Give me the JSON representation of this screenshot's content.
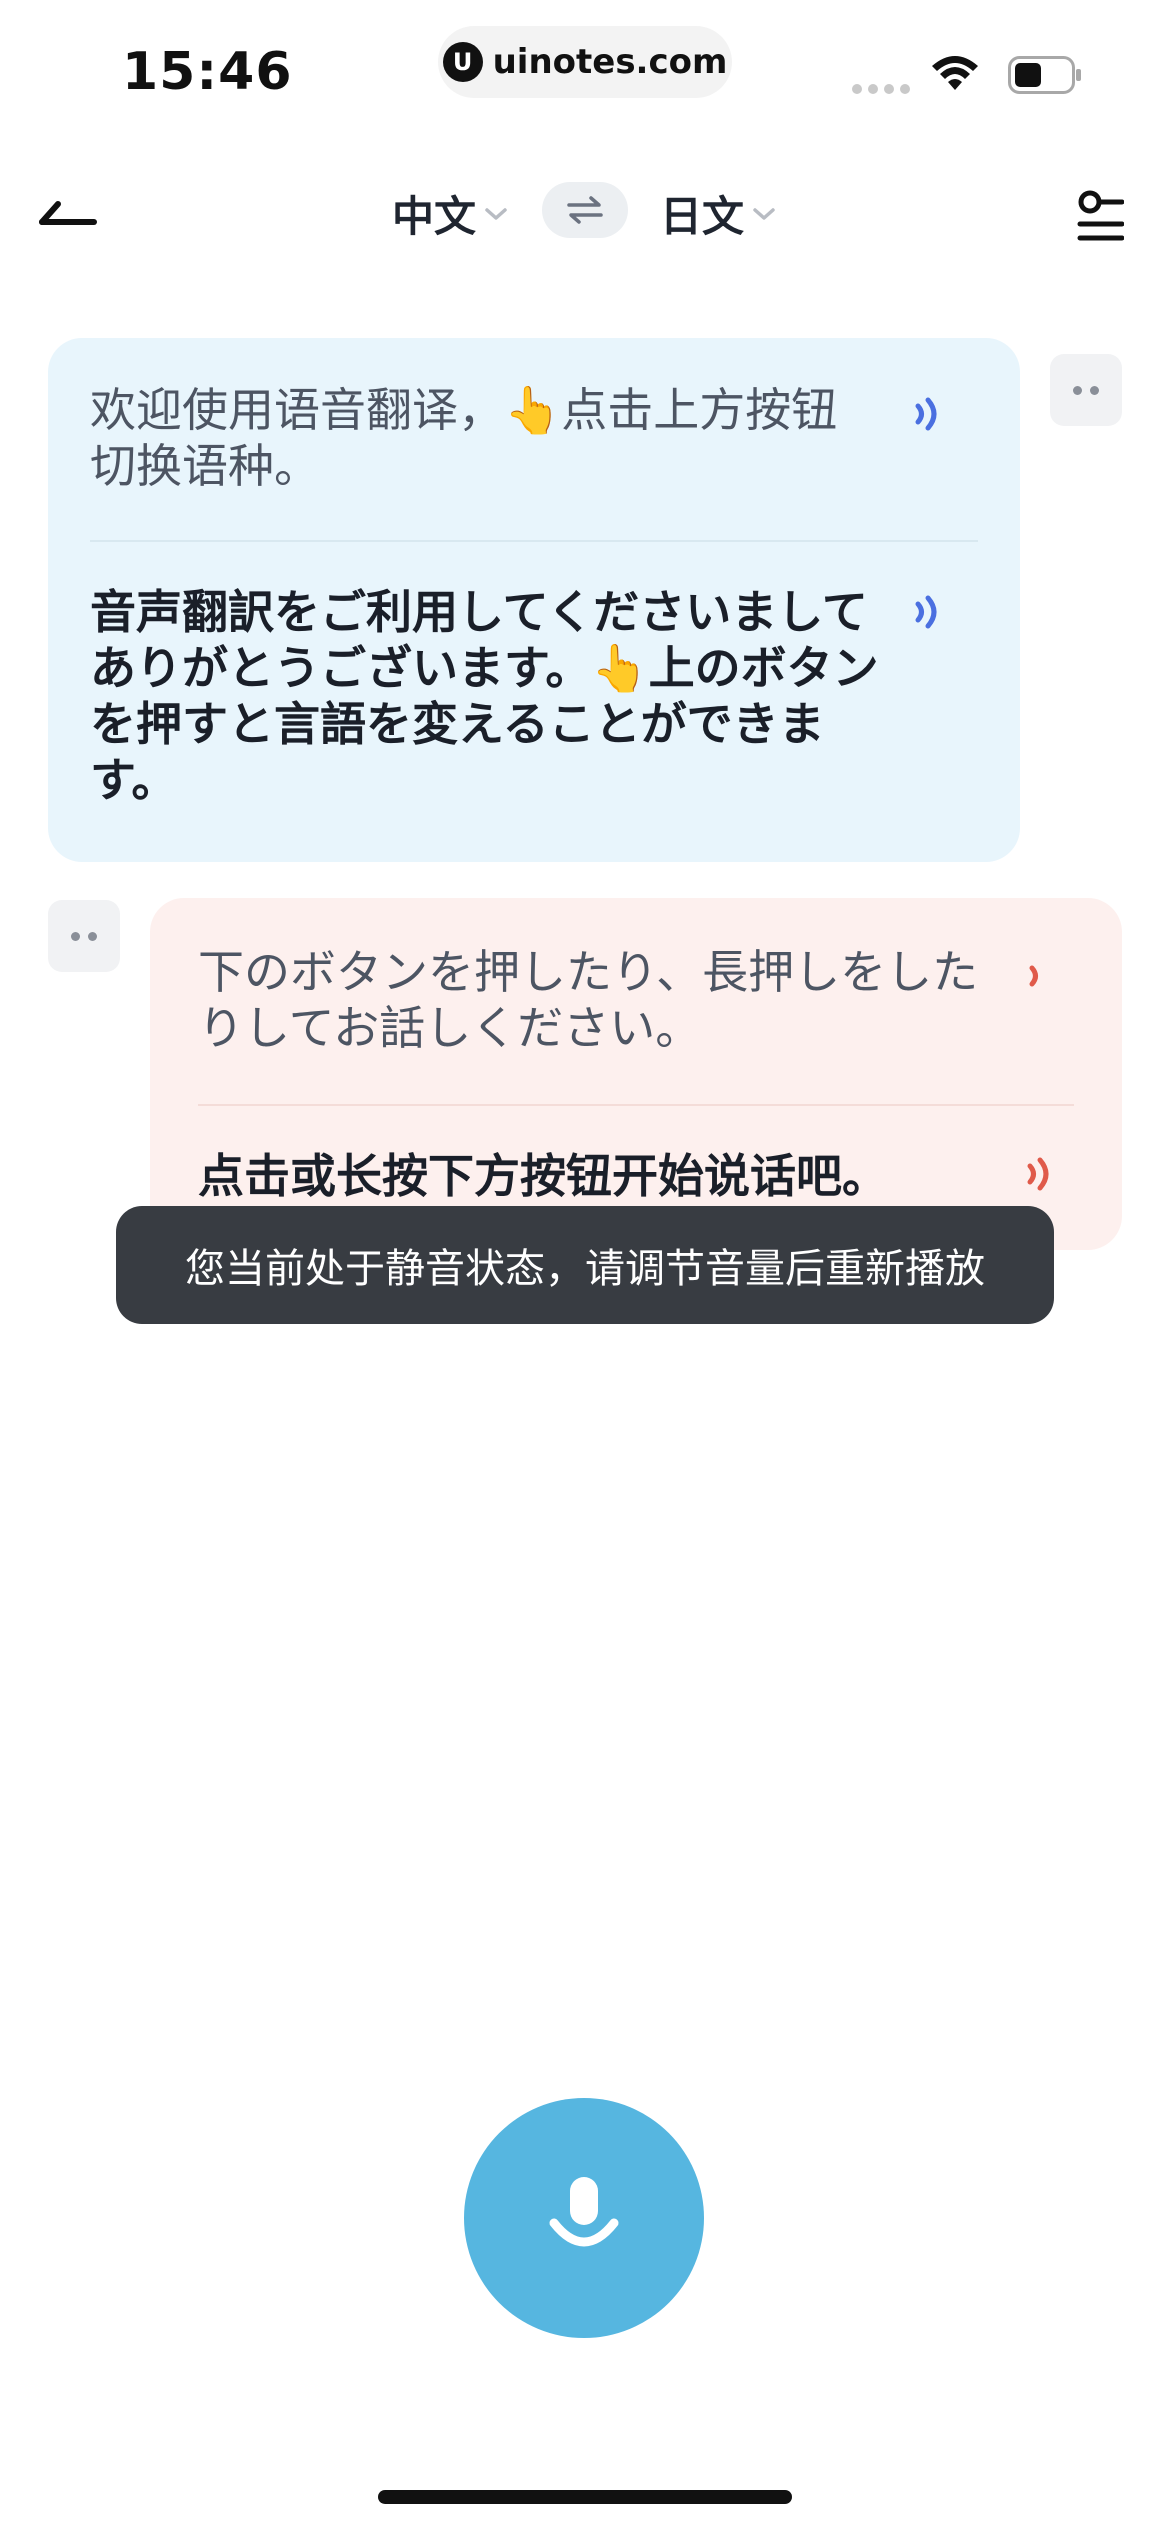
{
  "status_bar": {
    "time": "15:46",
    "url": "uinotes.com",
    "url_logo": "U"
  },
  "nav": {
    "back_icon": "back-arrow-icon",
    "source_language": "中文",
    "target_language": "日文",
    "swap_icon": "swap-arrows-icon",
    "settings_icon": "settings-sliders-icon"
  },
  "conversation": [
    {
      "side": "left",
      "color": "#e8f5fc",
      "accent": "#4a6fe0",
      "original": "欢迎使用语音翻译，👆点击上方按钮切换语种。",
      "translation": "音声翻訳をご利用してくださいましてありがとうございます。👆上のボタンを押すと言語を変えることができます。"
    },
    {
      "side": "right",
      "color": "#fdf0ee",
      "accent": "#e05a4a",
      "original": "下のボタンを押したり、長押しをしたりしてお話しください。",
      "translation": "点击或长按下方按钮开始说话吧。"
    }
  ],
  "toast": "您当前处于静音状态，请调节音量后重新播放",
  "mic_icon": "microphone-icon"
}
